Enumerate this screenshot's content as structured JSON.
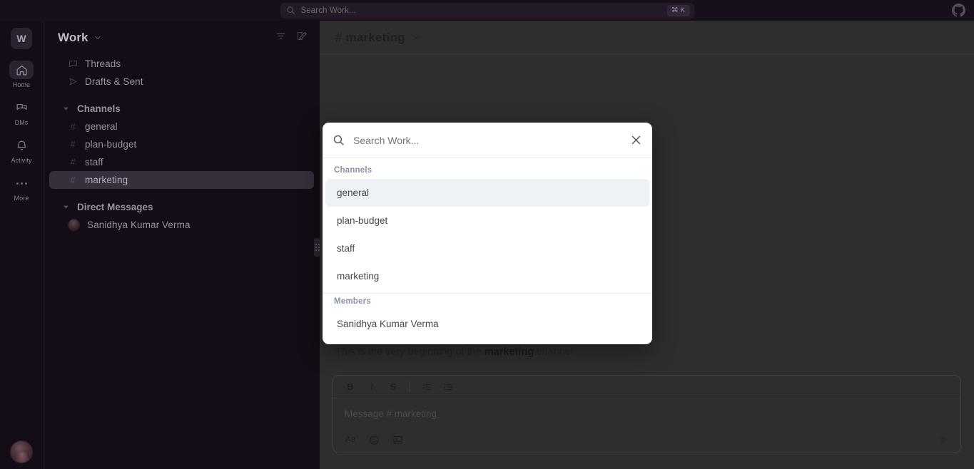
{
  "topbar": {
    "search_placeholder": "Search Work...",
    "shortcut_cmd": "⌘",
    "shortcut_key": "K",
    "github_icon": "github-icon",
    "search_icon": "search-icon"
  },
  "rail": {
    "workspace_initial": "W",
    "items": [
      {
        "label": "Home",
        "icon": "home-icon",
        "active": true
      },
      {
        "label": "DMs",
        "icon": "chat-bubbles-icon",
        "active": false
      },
      {
        "label": "Activity",
        "icon": "bell-icon",
        "active": false
      },
      {
        "label": "More",
        "icon": "ellipsis-icon",
        "active": false
      }
    ],
    "avatar": "user-avatar"
  },
  "sidebar": {
    "title": "Work",
    "caret_icon": "chevron-down-icon",
    "actions": [
      {
        "name": "filter-icon"
      },
      {
        "name": "compose-icon"
      }
    ],
    "quick_links": [
      {
        "label": "Threads",
        "icon": "threads-icon"
      },
      {
        "label": "Drafts & Sent",
        "icon": "send-icon"
      }
    ],
    "channels_section": "Channels",
    "channels": [
      {
        "label": "general",
        "selected": false
      },
      {
        "label": "plan-budget",
        "selected": false
      },
      {
        "label": "staff",
        "selected": false
      },
      {
        "label": "marketing",
        "selected": true
      }
    ],
    "dms_section": "Direct Messages",
    "dms": [
      {
        "label": "Sanidhya Kumar Verma"
      }
    ]
  },
  "main": {
    "channel_prefix": "#",
    "channel_name": "marketing",
    "channel_title": "# marketing",
    "caret_icon": "chevron-down-icon",
    "intro_prefix": "This is the very beginning of the ",
    "intro_channel": "marketing",
    "intro_suffix": " channel."
  },
  "composer": {
    "placeholder": "Message # marketing",
    "toolbar": [
      {
        "name": "bold-button",
        "glyph": "B"
      },
      {
        "name": "italic-button",
        "glyph": "I"
      },
      {
        "name": "strikethrough-button",
        "glyph": "S"
      },
      {
        "name": "ordered-list-button",
        "glyph": ""
      },
      {
        "name": "bullet-list-button",
        "glyph": ""
      }
    ],
    "footer": [
      {
        "name": "format-text-button",
        "glyph": "Aa"
      },
      {
        "name": "emoji-button",
        "glyph": ""
      },
      {
        "name": "image-button",
        "glyph": ""
      }
    ],
    "send_label": "send-button"
  },
  "modal": {
    "search_placeholder": "Search Work...",
    "search_value": "",
    "search_icon": "search-icon",
    "close_icon": "close-icon",
    "groups": [
      {
        "label": "Channels",
        "items": [
          {
            "label": "general",
            "active": true
          },
          {
            "label": "plan-budget",
            "active": false
          },
          {
            "label": "staff",
            "active": false
          },
          {
            "label": "marketing",
            "active": false
          }
        ]
      },
      {
        "label": "Members",
        "items": [
          {
            "label": "Sanidhya Kumar Verma",
            "active": false
          }
        ]
      }
    ]
  },
  "colors": {
    "sidebar_bg": "#140c16",
    "main_bg": "#2e2e2e",
    "modal_bg": "#ffffff",
    "modal_active": "#eef1f6",
    "selected_row": "#382f3c"
  }
}
